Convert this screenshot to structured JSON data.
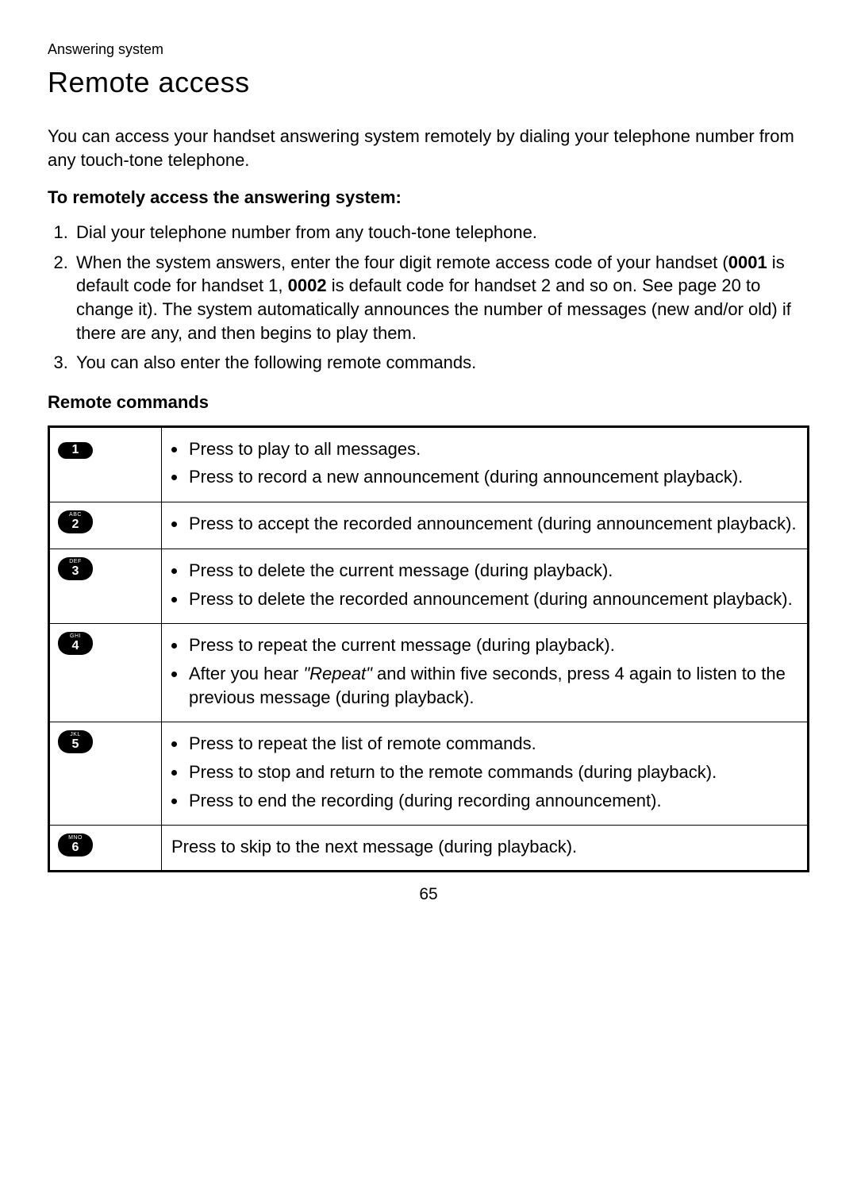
{
  "section_label": "Answering system",
  "page_title": "Remote access",
  "intro": "You can access your handset answering system remotely by dialing your telephone number from any touch-tone telephone.",
  "sub_heading": "To remotely access the answering system:",
  "steps": {
    "step1": "Dial your telephone number from any touch-tone telephone.",
    "step2_pre": "When the system answers, enter the four digit remote access code of your handset (",
    "step2_code1": "0001",
    "step2_mid1": " is default code for handset 1, ",
    "step2_code2": "0002",
    "step2_post": " is default code for handset 2 and so on. See page 20 to change it). The system automatically announces the number of messages (new and/or old) if there are any, and then begins to play them.",
    "step3": "You can also enter the following remote commands."
  },
  "commands_heading": "Remote commands",
  "keys": {
    "k1_main": "1",
    "k1_sup": "",
    "k2_main": "2",
    "k2_sup": "ABC",
    "k3_main": "3",
    "k3_sup": "DEF",
    "k4_main": "4",
    "k4_sup": "GHI",
    "k5_main": "5",
    "k5_sup": "JKL",
    "k6_main": "6",
    "k6_sup": "MNO"
  },
  "desc": {
    "r1a": "Press to play to all messages.",
    "r1b": "Press to record a new announcement (during announcement playback).",
    "r2a": "Press to accept the recorded announcement (during announcement playback).",
    "r3a": "Press to delete the current message (during playback).",
    "r3b": "Press to delete the recorded announcement (during announcement playback).",
    "r4a": "Press to repeat the current message (during playback).",
    "r4b_pre": "After you hear ",
    "r4b_em": "\"Repeat\"",
    "r4b_post": " and within five seconds, press 4 again to listen to the previous message (during playback).",
    "r5a": "Press to repeat the list of remote commands.",
    "r5b": "Press to stop and return to the remote commands (during playback).",
    "r5c": "Press to end the recording (during recording announcement).",
    "r6": "Press to skip to the next message (during playback)."
  },
  "page_number": "65"
}
